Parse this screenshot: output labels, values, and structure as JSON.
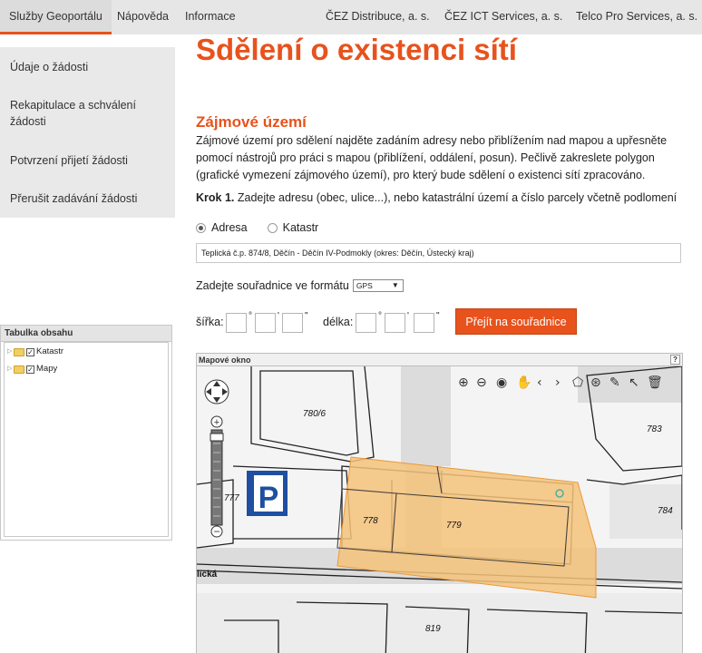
{
  "nav": {
    "left": [
      "Služby Geoportálu",
      "Nápověda",
      "Informace"
    ],
    "right": [
      "ČEZ Distribuce, a. s.",
      "ČEZ ICT Services, a. s.",
      "Telco Pro Services, a. s."
    ]
  },
  "sidebar": {
    "items": [
      "Údaje o žádosti",
      "Rekapitulace a schválení žádosti",
      "Potvrzení přijetí žádosti",
      "Přerušit zadávání žádosti"
    ]
  },
  "toc": {
    "title": "Tabulka obsahu",
    "nodes": [
      "Katastr",
      "Mapy"
    ]
  },
  "main": {
    "title": "Sdělení o existenci sítí",
    "section_title": "Zájmové území",
    "description": "Zájmové území pro sdělení najděte zadáním adresy nebo přiblížením nad mapou a upřesněte pomocí nástrojů pro práci s mapou (přiblížení, oddálení, posun). Pečlivě zakreslete polygon (grafické vymezení zájmového území), pro který bude sdělení o existenci sítí zpracováno.",
    "step_label": "Krok 1.",
    "step_text": " Zadejte adresu (obec, ulice...), nebo katastrální území a číslo parcely včetně podlomení",
    "radio_address": "Adresa",
    "radio_cadastre": "Katastr",
    "address_value": "Teplická č.p. 874/8, Děčín - Děčín IV-Podmokly (okres: Děčín, Ústecký kraj)",
    "coord_format_label": "Zadejte souřadnice ve formátu",
    "coord_format_value": "GPS",
    "lat_label": "šířka:",
    "lon_label": "délka:",
    "deg_symbol": "°",
    "min_symbol": "'",
    "sec_symbol": "\"",
    "goto_button": "Přejít na souřadnice"
  },
  "map": {
    "window_title": "Mapové okno",
    "help": "?",
    "parcels": [
      "780/6",
      "777",
      "778",
      "779",
      "783",
      "784",
      "819"
    ],
    "street_fragment": "lická",
    "colors": {
      "accent": "#e8521c",
      "polygon_fill": "#f5c27a",
      "polygon_stroke": "#e89a3a"
    }
  }
}
